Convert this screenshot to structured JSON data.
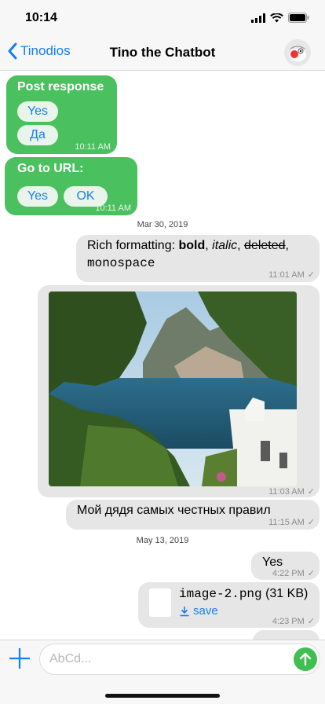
{
  "status": {
    "time": "10:14"
  },
  "nav": {
    "back_label": "Tinodios",
    "title": "Tino the Chatbot"
  },
  "messages": {
    "post_response": {
      "title": "Post response",
      "buttons": [
        "Yes",
        "Да"
      ],
      "time": "10:11 AM"
    },
    "go_to_url": {
      "title": "Go to URL:",
      "buttons": [
        "Yes",
        "OK"
      ],
      "time": "10:11 AM"
    },
    "date1": "Mar 30, 2019",
    "rich": {
      "prefix": "Rich formatting: ",
      "bold": "bold",
      "sep1": ", ",
      "italic": "italic",
      "sep2": ", ",
      "deleted": "deleted",
      "sep3": ",",
      "mono": "monospace",
      "time": "11:01 AM"
    },
    "photo": {
      "time": "11:03 AM"
    },
    "russian": {
      "text": "Мой дядя самых честных правил",
      "time": "11:15 AM"
    },
    "date2": "May 13, 2019",
    "yes": {
      "text": "Yes",
      "time": "4:22 PM"
    },
    "file": {
      "name": "image-2.png",
      "size": " (31 KB)",
      "save_label": "save",
      "time": "4:23 PM"
    }
  },
  "composer": {
    "placeholder": "AbCd..."
  },
  "colors": {
    "incoming": "#4ac15e",
    "outgoing": "#e6e6e6",
    "accent": "#147efb",
    "send": "#3fbf4f"
  }
}
